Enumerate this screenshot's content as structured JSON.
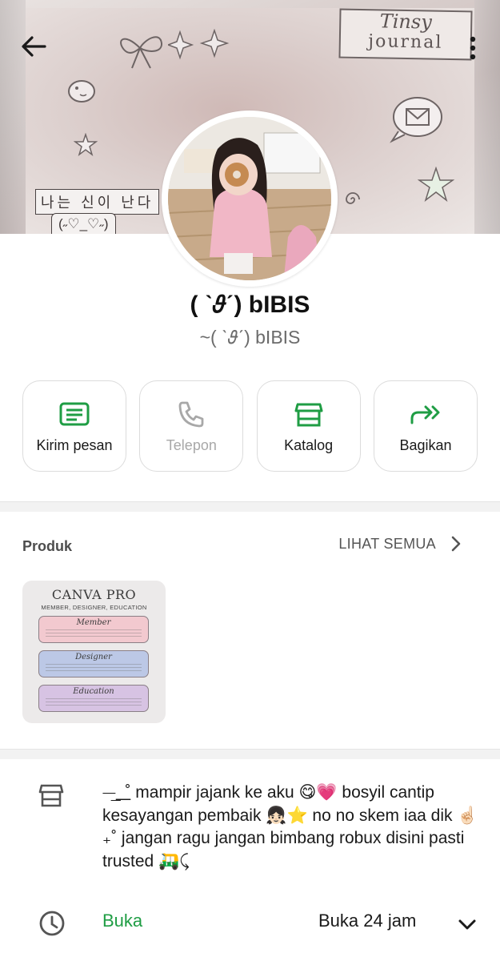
{
  "header": {
    "cover": {
      "journal_sticker": {
        "line1": "Tinsy",
        "line2": "journal"
      },
      "korean_sticker": "나는 신이 난다",
      "emoticon_sticker": "(˶♡_♡˶)"
    }
  },
  "profile": {
    "name": "( ˋ𝜗ˊ) bIBIS",
    "subname": "~( ˋ𝜗ˊ) bIBIS"
  },
  "actions": [
    {
      "label": "Kirim pesan",
      "icon": "message-icon",
      "enabled": true
    },
    {
      "label": "Telepon",
      "icon": "phone-icon",
      "enabled": false
    },
    {
      "label": "Katalog",
      "icon": "store-icon",
      "enabled": true
    },
    {
      "label": "Bagikan",
      "icon": "share-icon",
      "enabled": true
    }
  ],
  "products": {
    "title": "Produk",
    "see_all": "LIHAT SEMUA",
    "items": [
      {
        "title": "CANVA PRO",
        "subtitle": "MEMBER, DESIGNER, EDUCATION",
        "sections": [
          "Member",
          "Designer",
          "Education"
        ]
      }
    ]
  },
  "about": {
    "description": "⏤͟͟ ͟͟ ˚ mampir jajank ke aku 😋💗 bosyil cantip kesayangan pembaik 👧🏻⭐ no no skem iaa dik ☝🏻 ₊˚ jangan ragu jangan bimbang robux disini pasti trusted 🛺⤹"
  },
  "hours": {
    "status": "Buka",
    "value": "Buka 24 jam"
  },
  "colors": {
    "accent_green": "#1f9d44",
    "disabled_gray": "#a8a8a8",
    "text_dark": "#1a1a1a"
  }
}
